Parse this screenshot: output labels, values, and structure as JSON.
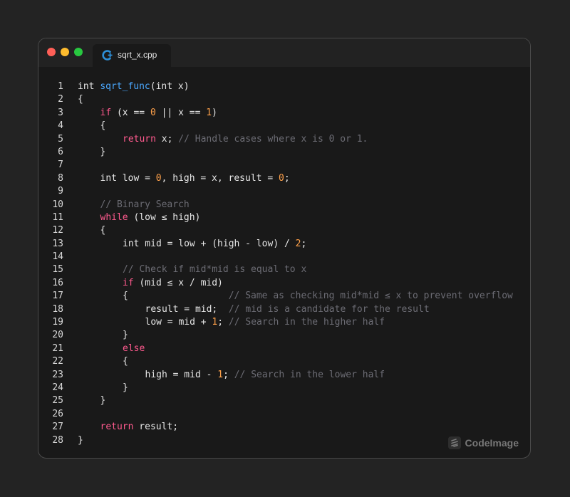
{
  "tab": {
    "filename": "sqrt_x.cpp",
    "icon": "cpp-file-icon",
    "icon_color": "#2d8fd8"
  },
  "colors": {
    "background": "#232323",
    "editor": "#191919",
    "keyword": "#ff5a8e",
    "function": "#4aa8ff",
    "number": "#ffa14a",
    "comment": "#6c6c74",
    "text": "#e6e6e6"
  },
  "watermark": {
    "text": "CodeImage",
    "icon": "codeimage-logo-icon"
  },
  "code_lines": [
    {
      "n": "1",
      "indent": 0,
      "parts": [
        {
          "t": "int "
        },
        {
          "t": "sqrt_func",
          "c": "fn"
        },
        {
          "t": "(int x)"
        }
      ]
    },
    {
      "n": "2",
      "indent": 0,
      "parts": [
        {
          "t": "{"
        }
      ]
    },
    {
      "n": "3",
      "indent": 1,
      "parts": [
        {
          "t": "if",
          "c": "kw"
        },
        {
          "t": " (x == "
        },
        {
          "t": "0",
          "c": "num"
        },
        {
          "t": " || x == "
        },
        {
          "t": "1",
          "c": "num"
        },
        {
          "t": ")"
        }
      ]
    },
    {
      "n": "4",
      "indent": 1,
      "parts": [
        {
          "t": "{"
        }
      ]
    },
    {
      "n": "5",
      "indent": 2,
      "parts": [
        {
          "t": "return",
          "c": "kw"
        },
        {
          "t": " x; "
        },
        {
          "t": "// Handle cases where x is 0 or 1.",
          "c": "cm"
        }
      ]
    },
    {
      "n": "6",
      "indent": 1,
      "parts": [
        {
          "t": "}"
        }
      ]
    },
    {
      "n": "7",
      "indent": 0,
      "parts": []
    },
    {
      "n": "8",
      "indent": 1,
      "parts": [
        {
          "t": "int low = "
        },
        {
          "t": "0",
          "c": "num"
        },
        {
          "t": ", high = x, result = "
        },
        {
          "t": "0",
          "c": "num"
        },
        {
          "t": ";"
        }
      ]
    },
    {
      "n": "9",
      "indent": 0,
      "parts": []
    },
    {
      "n": "10",
      "indent": 1,
      "parts": [
        {
          "t": "// Binary Search",
          "c": "cm"
        }
      ]
    },
    {
      "n": "11",
      "indent": 1,
      "parts": [
        {
          "t": "while",
          "c": "kw"
        },
        {
          "t": " (low ≤ high)"
        }
      ]
    },
    {
      "n": "12",
      "indent": 1,
      "parts": [
        {
          "t": "{"
        }
      ]
    },
    {
      "n": "13",
      "indent": 2,
      "parts": [
        {
          "t": "int mid = low + (high - low) / "
        },
        {
          "t": "2",
          "c": "num"
        },
        {
          "t": ";"
        }
      ]
    },
    {
      "n": "14",
      "indent": 0,
      "parts": []
    },
    {
      "n": "15",
      "indent": 2,
      "parts": [
        {
          "t": "// Check if mid*mid is equal to x",
          "c": "cm"
        }
      ]
    },
    {
      "n": "16",
      "indent": 2,
      "parts": [
        {
          "t": "if",
          "c": "kw"
        },
        {
          "t": " (mid ≤ x / mid)"
        }
      ]
    },
    {
      "n": "17",
      "indent": 2,
      "parts": [
        {
          "t": "{                  "
        },
        {
          "t": "// Same as checking mid*mid ≤ x to prevent overflow",
          "c": "cm"
        }
      ]
    },
    {
      "n": "18",
      "indent": 3,
      "parts": [
        {
          "t": "result = mid;  "
        },
        {
          "t": "// mid is a candidate for the result",
          "c": "cm"
        }
      ]
    },
    {
      "n": "19",
      "indent": 3,
      "parts": [
        {
          "t": "low = mid + "
        },
        {
          "t": "1",
          "c": "num"
        },
        {
          "t": "; "
        },
        {
          "t": "// Search in the higher half",
          "c": "cm"
        }
      ]
    },
    {
      "n": "20",
      "indent": 2,
      "parts": [
        {
          "t": "}"
        }
      ]
    },
    {
      "n": "21",
      "indent": 2,
      "parts": [
        {
          "t": "else",
          "c": "kw"
        }
      ]
    },
    {
      "n": "22",
      "indent": 2,
      "parts": [
        {
          "t": "{"
        }
      ]
    },
    {
      "n": "23",
      "indent": 3,
      "parts": [
        {
          "t": "high = mid - "
        },
        {
          "t": "1",
          "c": "num"
        },
        {
          "t": "; "
        },
        {
          "t": "// Search in the lower half",
          "c": "cm"
        }
      ]
    },
    {
      "n": "24",
      "indent": 2,
      "parts": [
        {
          "t": "}"
        }
      ]
    },
    {
      "n": "25",
      "indent": 1,
      "parts": [
        {
          "t": "}"
        }
      ]
    },
    {
      "n": "26",
      "indent": 0,
      "parts": []
    },
    {
      "n": "27",
      "indent": 1,
      "parts": [
        {
          "t": "return",
          "c": "kw"
        },
        {
          "t": " result;"
        }
      ]
    },
    {
      "n": "28",
      "indent": 0,
      "parts": [
        {
          "t": "}"
        }
      ]
    }
  ]
}
